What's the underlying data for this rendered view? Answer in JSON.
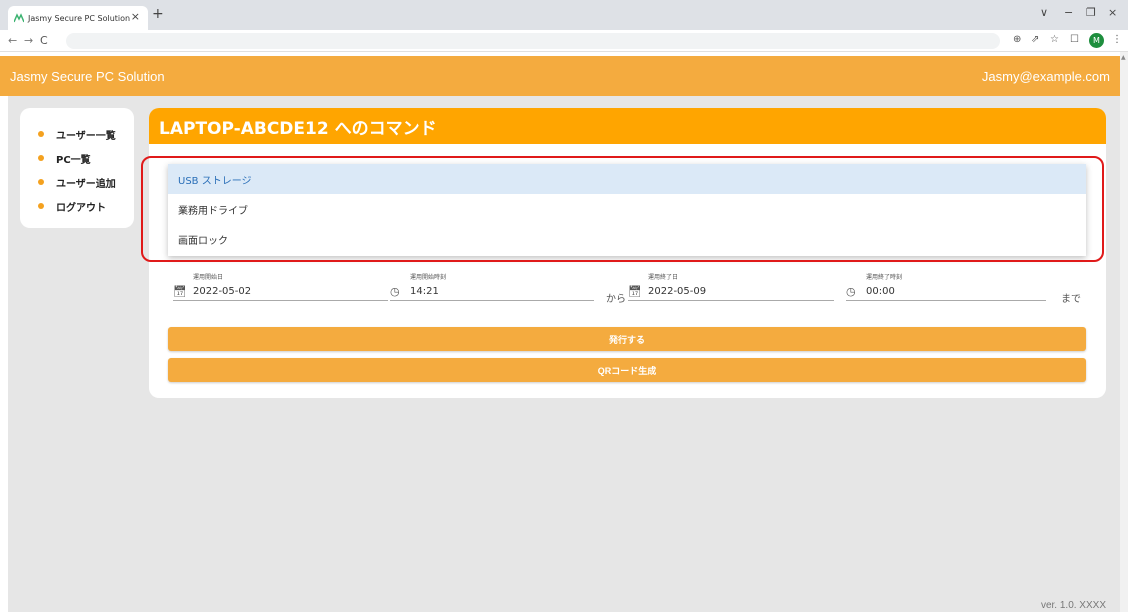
{
  "browser": {
    "tab_title": "Jasmy Secure PC Solution",
    "tab_close": "×",
    "new_tab": "+",
    "win_controls": [
      "∨",
      "−",
      "❐",
      "×"
    ],
    "nav": [
      "←",
      "→",
      "C"
    ],
    "tools": [
      "⊕",
      "⇗",
      "☆",
      "☐"
    ],
    "avatar_initial": "M",
    "menu": "⋮"
  },
  "app": {
    "title": "Jasmy Secure PC Solution",
    "user_email": "Jasmy@example.com",
    "version": "ver. 1.0. XXXX"
  },
  "sidebar": {
    "items": [
      {
        "label": "ユーザー一覧"
      },
      {
        "label": "PC一覧"
      },
      {
        "label": "ユーザー追加"
      },
      {
        "label": "ログアウト"
      }
    ]
  },
  "main": {
    "title": "LAPTOP-ABCDE12 へのコマンド",
    "dropdown": {
      "options": [
        {
          "label": "USB ストレージ",
          "selected": true
        },
        {
          "label": "業務用ドライブ",
          "selected": false
        },
        {
          "label": "画面ロック",
          "selected": false
        }
      ]
    },
    "fields": {
      "start_date": {
        "label": "運用開始日",
        "value": "2022-05-02"
      },
      "start_time": {
        "label": "運用開始時刻",
        "value": "14:21"
      },
      "from_text": "から",
      "end_date": {
        "label": "運用終了日",
        "value": "2022-05-09"
      },
      "end_time": {
        "label": "運用終了時刻",
        "value": "00:00"
      },
      "until_text": "まで"
    },
    "buttons": {
      "issue": "発行する",
      "qr": "QRコード生成"
    }
  },
  "colors": {
    "accent": "#f4ab3f",
    "header": "#ffa500",
    "highlight": "#e01a1a",
    "selected_bg": "#dbe9f7"
  }
}
